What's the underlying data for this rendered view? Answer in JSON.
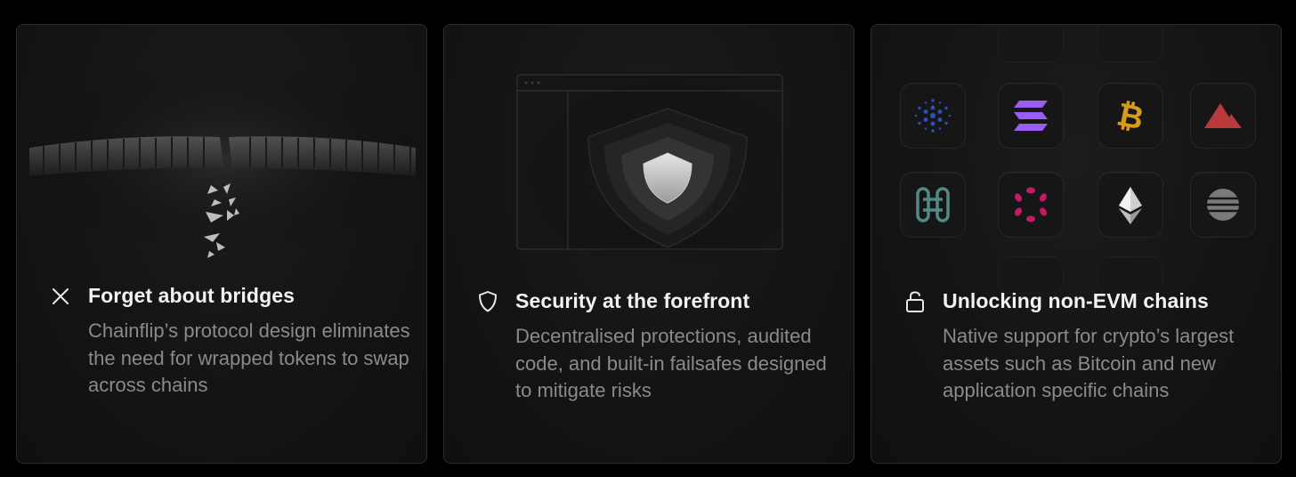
{
  "cards": [
    {
      "title": "Forget about bridges",
      "description": "Chainflip’s protocol design eliminates the need for wrapped tokens to swap across chains",
      "icon": "close-icon"
    },
    {
      "title": "Security at the forefront",
      "description": "Decentralised protections, audited code, and built-in failsafes designed to mitigate risks",
      "icon": "shield-icon"
    },
    {
      "title": "Unlocking non-EVM chains",
      "description": "Native support for crypto’s largest assets such as Bitcoin and new application specific chains",
      "icon": "unlock-icon"
    }
  ],
  "chain_logos": [
    "cardano-icon",
    "solana-icon",
    "bitcoin-icon",
    "avalanche-icon",
    "hedera-icon",
    "polkadot-icon",
    "ethereum-icon",
    "aptos-icon"
  ],
  "colors": {
    "background": "#000000",
    "card_border": "#2c2c2c",
    "title": "#f2f2f2",
    "description": "#8a8a8a",
    "solana": "#9b5cf0",
    "bitcoin": "#d89a1a",
    "avalanche": "#b83a3a",
    "cardano": "#2d50b8",
    "polkadot": "#c41a66",
    "hedera": "#4f8a85"
  }
}
